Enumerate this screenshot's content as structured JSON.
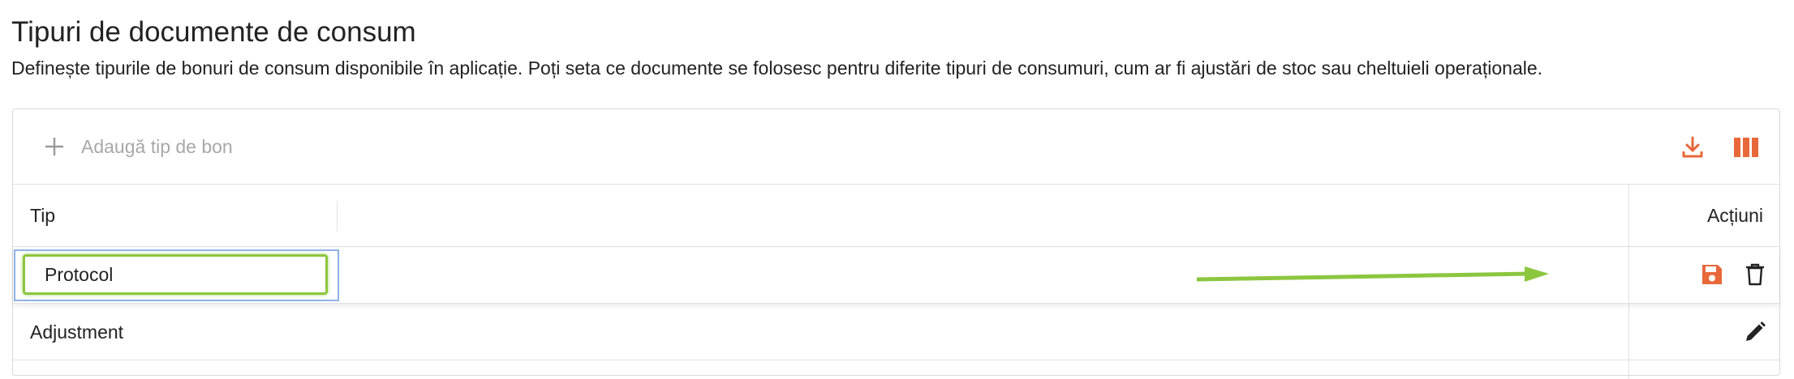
{
  "page": {
    "title": "Tipuri de documente de consum",
    "description": "Definește tipurile de bonuri de consum disponibile în aplicație. Poți seta ce documente se folosesc pentru diferite tipuri de consumuri, cum ar fi ajustări de stoc sau cheltuieli operaționale."
  },
  "toolbar": {
    "add_label": "Adaugă tip de bon",
    "add_icon": "plus-icon",
    "download_icon": "download-icon",
    "columns_icon": "columns-icon"
  },
  "table": {
    "columns": [
      "Tip",
      "Acțiuni"
    ],
    "rows": [
      {
        "tip": "Protocol",
        "editing": true,
        "actions": [
          "save-icon",
          "delete-icon"
        ]
      },
      {
        "tip": "Adjustment",
        "editing": false,
        "actions": [
          "edit-icon"
        ]
      }
    ]
  },
  "colors": {
    "accent": "#e8683a",
    "annotation_green": "#8cc63f",
    "focus_blue": "#8fb2e6"
  }
}
